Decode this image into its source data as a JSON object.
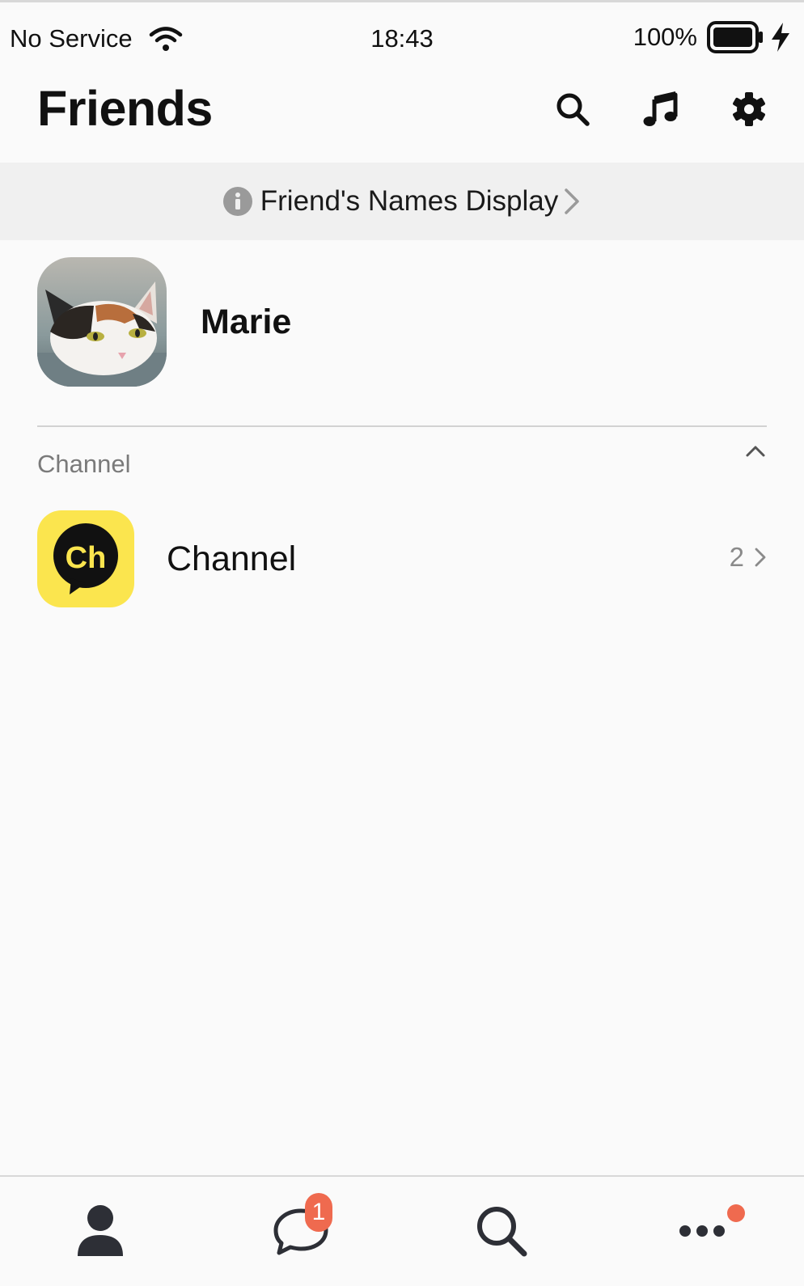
{
  "status_bar": {
    "carrier": "No Service",
    "time": "18:43",
    "battery_percent": "100%"
  },
  "header": {
    "title": "Friends",
    "icons": [
      "search-icon",
      "music-note-icon",
      "gear-icon"
    ]
  },
  "banner": {
    "text": "Friend's Names Display"
  },
  "profile": {
    "name": "Marie",
    "avatar": "cat-photo"
  },
  "channel_section": {
    "label": "Channel",
    "row": {
      "label": "Channel",
      "logo_text": "Ch",
      "count": "2"
    }
  },
  "tabbar": {
    "tabs": [
      {
        "icon": "person-icon"
      },
      {
        "icon": "chat-bubble-icon",
        "badge": "1"
      },
      {
        "icon": "search-icon"
      },
      {
        "icon": "more-dots-icon"
      }
    ]
  },
  "colors": {
    "badge": "#ef6a4f",
    "channel_logo": "#fbe54e",
    "background": "#fafafa"
  }
}
